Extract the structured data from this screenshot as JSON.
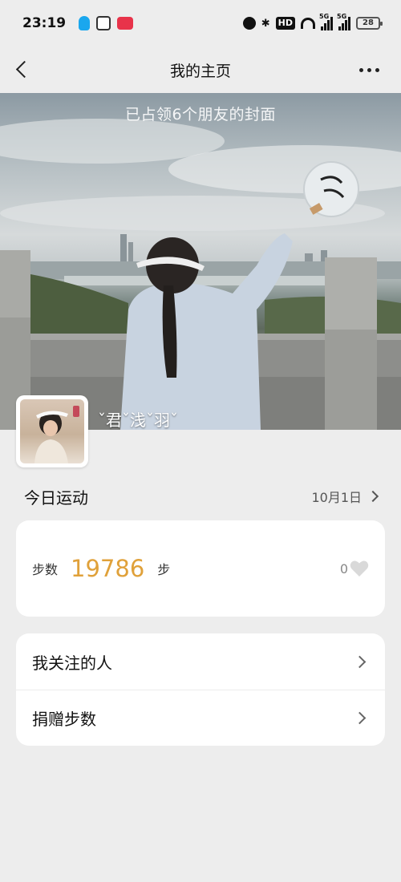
{
  "status_bar": {
    "time": "23:19",
    "battery": "28",
    "hd": "HD",
    "signal_1": "5G",
    "signal_2": "5G"
  },
  "nav": {
    "title": "我的主页"
  },
  "cover": {
    "caption": "已占领6个朋友的封面"
  },
  "profile": {
    "username": "ˇ君ˇ浅ˇ羽ˇ"
  },
  "today": {
    "title": "今日运动",
    "date": "10月1日"
  },
  "steps": {
    "label": "步数",
    "value": "19786",
    "unit": "步",
    "likes": "0"
  },
  "menu": {
    "items": [
      {
        "label": "我关注的人"
      },
      {
        "label": "捐赠步数"
      }
    ]
  },
  "colors": {
    "accent": "#e0a13a",
    "background": "#ededed"
  }
}
